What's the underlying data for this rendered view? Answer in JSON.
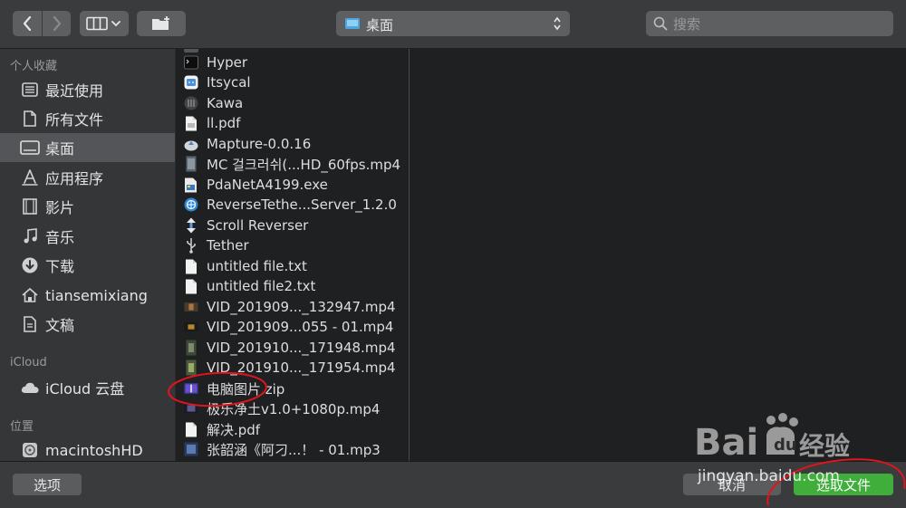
{
  "toolbar": {
    "location": "桌面",
    "search_placeholder": "搜索"
  },
  "sidebar": {
    "sections": [
      {
        "header": "个人收藏"
      },
      {
        "header": "iCloud"
      },
      {
        "header": "位置"
      }
    ],
    "favorites": [
      {
        "label": "最近使用",
        "icon": "clock-icon"
      },
      {
        "label": "所有文件",
        "icon": "documents-icon"
      },
      {
        "label": "桌面",
        "icon": "desktop-icon",
        "selected": true
      },
      {
        "label": "应用程序",
        "icon": "applications-icon"
      },
      {
        "label": "影片",
        "icon": "film-icon"
      },
      {
        "label": "音乐",
        "icon": "music-icon"
      },
      {
        "label": "下载",
        "icon": "download-icon"
      },
      {
        "label": "tiansemixiang",
        "icon": "home-icon"
      },
      {
        "label": "文稿",
        "icon": "document-icon"
      }
    ],
    "icloud": [
      {
        "label": "iCloud 云盘",
        "icon": "cloud-icon"
      }
    ],
    "locations": [
      {
        "label": "macintoshHD",
        "icon": "harddisk-icon"
      }
    ]
  },
  "files": [
    {
      "name": "Hyper",
      "icon": "terminal-app-icon"
    },
    {
      "name": "Itsycal",
      "icon": "calendar-app-icon"
    },
    {
      "name": "Kawa",
      "icon": "kawa-app-icon"
    },
    {
      "name": "ll.pdf",
      "icon": "pdf-file-icon"
    },
    {
      "name": "Mapture-0.0.16",
      "icon": "disk-image-icon"
    },
    {
      "name": "MC 걸크러쉬(...HD_60fps.mp4",
      "icon": "video-thumbnail-icon"
    },
    {
      "name": "PdaNetA4199.exe",
      "icon": "exe-file-icon"
    },
    {
      "name": "ReverseTethe...Server_1.2.0",
      "icon": "globe-app-icon"
    },
    {
      "name": "Scroll Reverser",
      "icon": "scroll-app-icon"
    },
    {
      "name": "Tether",
      "icon": "usb-app-icon"
    },
    {
      "name": "untitled file.txt",
      "icon": "text-file-icon"
    },
    {
      "name": "untitled file2.txt",
      "icon": "text-file-icon"
    },
    {
      "name": "VID_201909..._132947.mp4",
      "icon": "video-thumbnail-icon"
    },
    {
      "name": "VID_201909...055 - 01.mp4",
      "icon": "video-thumbnail-icon"
    },
    {
      "name": "VID_201910..._171948.mp4",
      "icon": "video-thumbnail-icon"
    },
    {
      "name": "VID_201910..._171954.mp4",
      "icon": "video-thumbnail-icon"
    },
    {
      "name": "电脑图片.zip",
      "icon": "zip-file-icon"
    },
    {
      "name": "极乐净土v1.0+1080p.mp4",
      "icon": "video-thumbnail-icon"
    },
    {
      "name": "解决.pdf",
      "icon": "pdf-file-icon"
    },
    {
      "name": "张韶涵《阿刁...！ - 01.mp3",
      "icon": "audio-file-icon"
    }
  ],
  "bottom": {
    "options_label": "选项",
    "cancel_label": "取消",
    "choose_label": "选取文件"
  },
  "watermark": {
    "brand": "Bai du 经验",
    "site": "jingyan.baidu.com"
  },
  "colors": {
    "accent_green": "#3fae3a",
    "annotation_red": "#e0141e",
    "selection": "#545558"
  }
}
